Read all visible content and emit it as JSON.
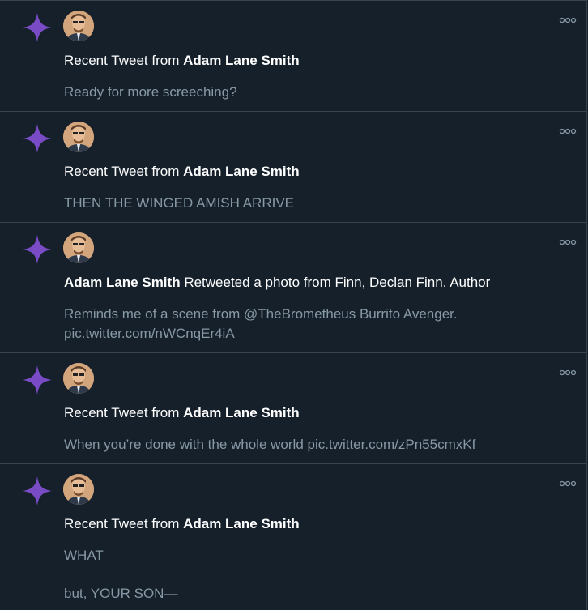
{
  "notifications": [
    {
      "type": "recent-tweet",
      "prefix": "Recent Tweet from ",
      "author": "Adam Lane Smith",
      "suffix": "",
      "body": [
        "Ready for more screeching?"
      ]
    },
    {
      "type": "recent-tweet",
      "prefix": "Recent Tweet from ",
      "author": "Adam Lane Smith",
      "suffix": "",
      "body": [
        "THEN THE WINGED AMISH ARRIVE"
      ]
    },
    {
      "type": "retweet",
      "prefix": "",
      "author": "Adam Lane Smith",
      "suffix": " Retweeted a photo from Finn, Declan Finn. Author",
      "body": [
        "Reminds me of a scene from @TheBrometheus Burrito Avenger.",
        "pic.twitter.com/nWCnqEr4iA"
      ]
    },
    {
      "type": "recent-tweet",
      "prefix": "Recent Tweet from ",
      "author": "Adam Lane Smith",
      "suffix": "",
      "body": [
        "When you’re done with the whole world pic.twitter.com/zPn55cmxKf"
      ]
    },
    {
      "type": "recent-tweet",
      "prefix": "Recent Tweet from ",
      "author": "Adam Lane Smith",
      "suffix": "",
      "body": [
        "WHAT",
        "but, YOUR SON—"
      ]
    }
  ],
  "icons": {
    "notification_icon": "sparkle-icon",
    "more": "more-options-icon"
  },
  "colors": {
    "background": "#15202b",
    "divider": "#38444d",
    "sparkle": "#794bc4",
    "primary_text": "#ffffff",
    "secondary_text": "#8899a6"
  }
}
